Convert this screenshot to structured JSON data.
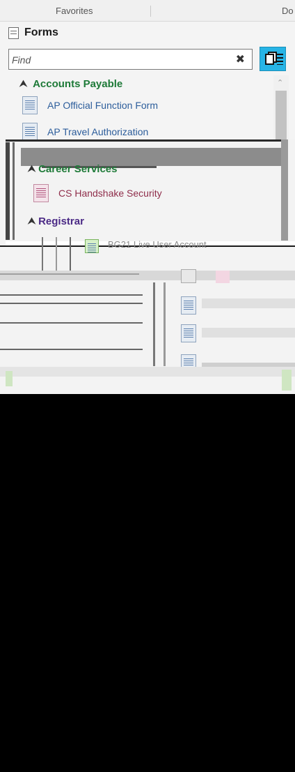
{
  "tabs": {
    "favorites": "Favorites",
    "documents": "Do"
  },
  "forms": {
    "title": "Forms"
  },
  "search": {
    "placeholder": "Find",
    "clear": "✖"
  },
  "groups": [
    {
      "name": "Accounts Payable",
      "items": [
        "AP Official Function Form",
        "AP Travel Authorization"
      ]
    },
    {
      "name": "Career Services",
      "items": [
        "CS Handshake Security"
      ]
    },
    {
      "name": "Registrar",
      "items": []
    }
  ],
  "glitch_fragments": {
    "user_account": "BG21 Live User Account"
  },
  "colors": {
    "accent": "#27b4e6",
    "group_green": "#1e7a38",
    "link_blue": "#2c5d9b",
    "link_red": "#8f2d4a",
    "registrar_purple": "#4b2a86"
  }
}
